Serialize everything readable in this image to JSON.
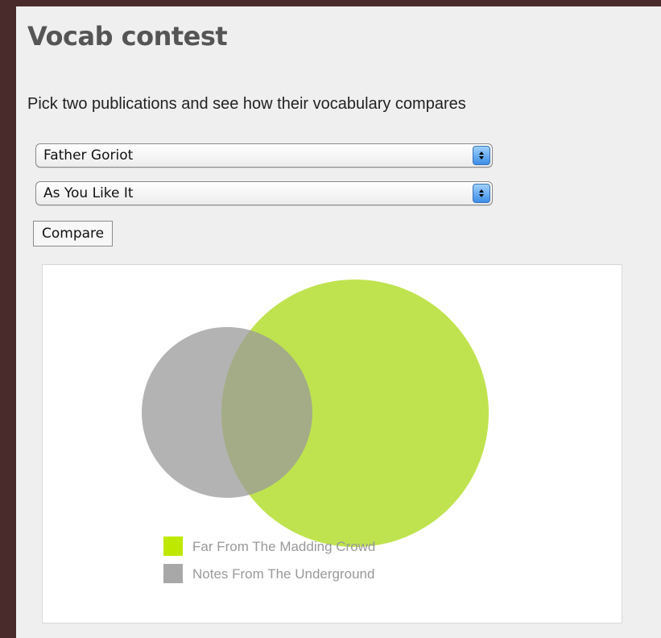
{
  "page": {
    "title": "Vocab contest",
    "subtitle": "Pick two publications and see how their vocabulary compares"
  },
  "form": {
    "select_1": {
      "selected": "Father Goriot"
    },
    "select_2": {
      "selected": "As You Like It"
    },
    "compare_label": "Compare",
    "stepper_icon": "stepper-arrows-icon"
  },
  "colors": {
    "background": "#4a2b2b",
    "panel": "#efefef",
    "series_a": "#bfe34f",
    "series_b": "#999999",
    "overlap": "#8f9c6a"
  },
  "chart_data": {
    "type": "venn",
    "sets": [
      {
        "name": "Far From The Madding Crowd",
        "color": "#bfe34f",
        "relative_size": 1.0
      },
      {
        "name": "Notes From The Underground",
        "color": "#999999",
        "relative_size": 0.41
      }
    ],
    "overlap_fraction_of_smaller": 0.72,
    "legend": [
      "Far From The Madding Crowd",
      "Notes From The Underground"
    ],
    "legend_position": "bottom"
  }
}
